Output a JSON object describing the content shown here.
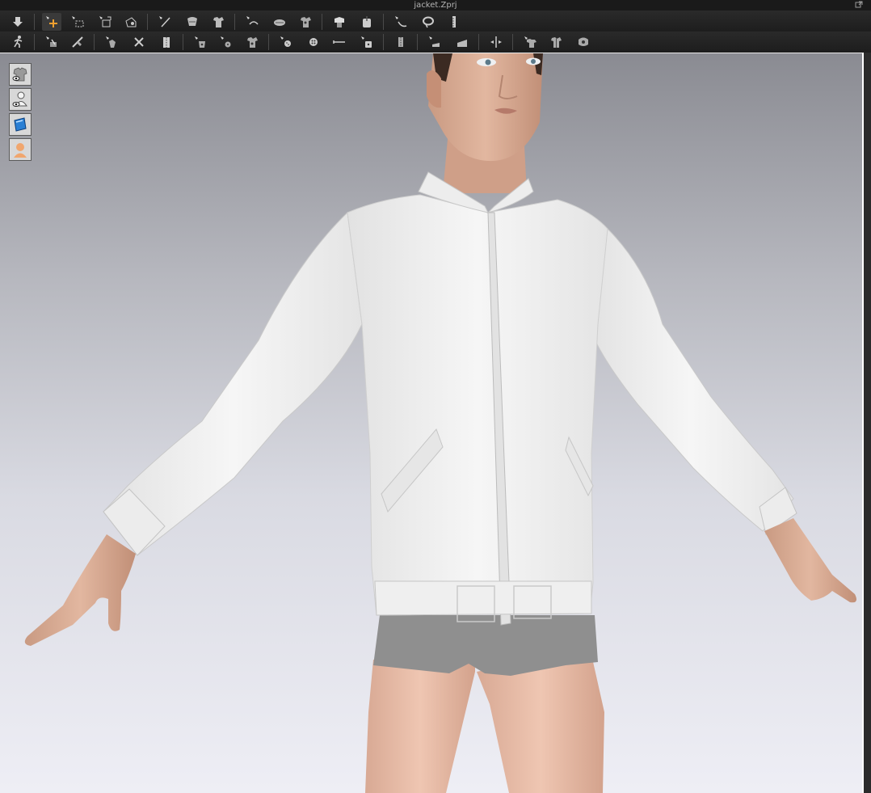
{
  "window": {
    "title": "jacket.Zprj"
  },
  "toolbar": {
    "row1": [
      {
        "name": "simulate-icon"
      },
      {
        "name": "select-move-icon",
        "active": true
      },
      {
        "name": "box-select-icon"
      },
      {
        "name": "transform-pattern-icon"
      },
      {
        "name": "edit-point-icon"
      },
      {
        "name": "sew-line-icon"
      },
      {
        "name": "segment-sewing-icon"
      },
      {
        "name": "free-sewing-icon"
      },
      {
        "name": "tack-icon"
      },
      {
        "name": "fold-arrangement-icon"
      },
      {
        "name": "shirring-icon"
      },
      {
        "name": "avatar-garment-icon"
      },
      {
        "name": "arrangement-point-icon"
      },
      {
        "name": "pin-icon"
      },
      {
        "name": "lasso-icon"
      },
      {
        "name": "measure-icon"
      }
    ],
    "row2": [
      {
        "name": "avatar-pose-icon"
      },
      {
        "name": "texture-edit-icon"
      },
      {
        "name": "graphic-edit-icon"
      },
      {
        "name": "puckering-icon"
      },
      {
        "name": "sew-trim-icon"
      },
      {
        "name": "zipper-icon"
      },
      {
        "name": "button-tool-icon"
      },
      {
        "name": "buttonhole-icon"
      },
      {
        "name": "button-select-icon"
      },
      {
        "name": "add-button-icon"
      },
      {
        "name": "topstitch-icon"
      },
      {
        "name": "tape-icon"
      },
      {
        "name": "lock-icon"
      },
      {
        "name": "elastic-icon"
      },
      {
        "name": "fold-icon"
      },
      {
        "name": "layer-icon"
      },
      {
        "name": "split-icon"
      },
      {
        "name": "garment-front-icon"
      },
      {
        "name": "garment-back-icon"
      },
      {
        "name": "garment-fitting-icon"
      }
    ]
  },
  "viewport": {
    "side_buttons": [
      {
        "name": "show-garment-icon"
      },
      {
        "name": "show-avatar-icon"
      },
      {
        "name": "show-texture-icon"
      },
      {
        "name": "avatar-skin-icon"
      }
    ],
    "colors": {
      "background_top": "#8a8b92",
      "background_bottom": "#eeeef5",
      "jacket": "#f2f2f2",
      "skin": "#dcae96",
      "briefs": "#8f8f8f"
    }
  }
}
